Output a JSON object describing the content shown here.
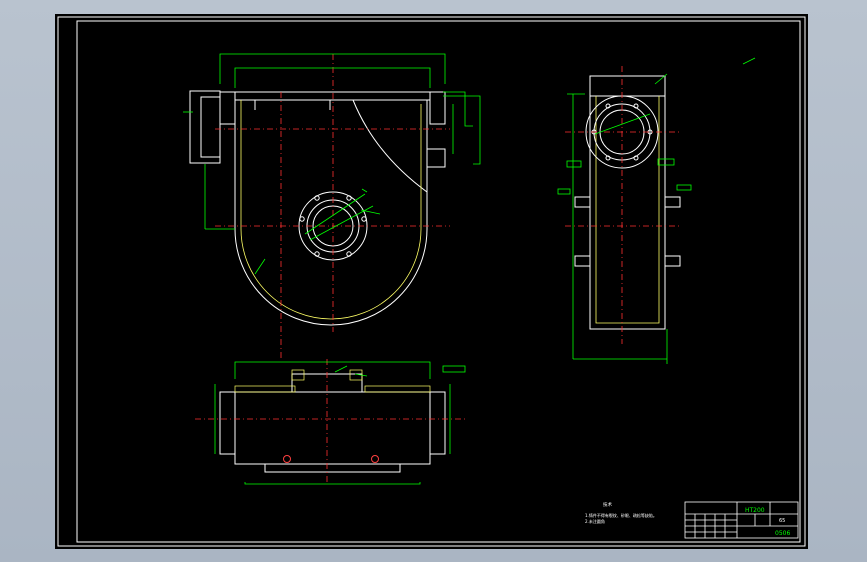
{
  "drawing": {
    "background": "#000000",
    "frame_color": "#ffffff",
    "geometry_color": "#ffffff",
    "dimension_color": "#00ff00",
    "centerline_color": "#ff0000",
    "hatch_color": "#ffff00"
  },
  "notes": {
    "title": "技术",
    "line1": "1.铸件不得有裂纹、砂眼、疏松等缺陷。",
    "line2": "2.未注圆角"
  },
  "title_block": {
    "material": "HT200",
    "scale": "65",
    "drawing_no": "0506"
  }
}
